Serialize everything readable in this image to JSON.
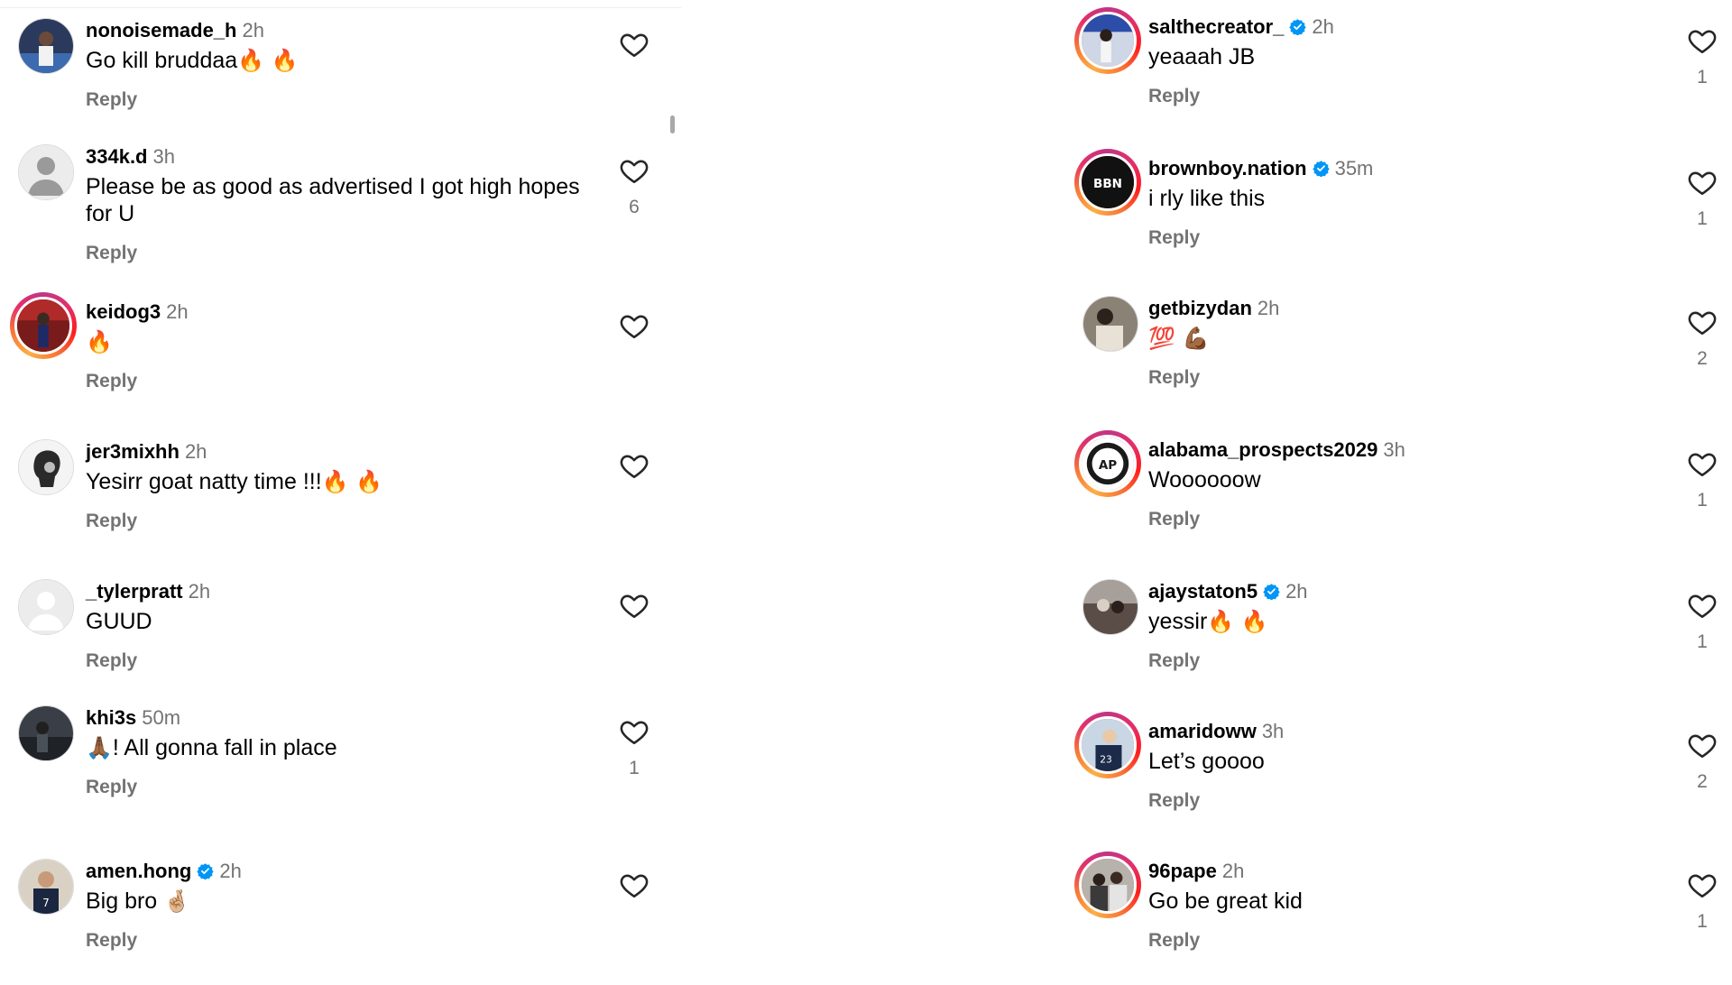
{
  "left_comments": [
    {
      "username": "nonoisemade_h",
      "verified": false,
      "time": "2h",
      "text": "Go kill bruddaa",
      "emoji": "🔥 🔥",
      "reply": "Reply",
      "likes": ""
    },
    {
      "username": "334k.d",
      "verified": false,
      "time": "3h",
      "text": "Please be as good as advertised I got high hopes for U",
      "emoji": "",
      "reply": "Reply",
      "likes": "6"
    },
    {
      "username": "keidog3",
      "verified": false,
      "time": "2h",
      "text": "",
      "emoji": "🔥",
      "reply": "Reply",
      "likes": ""
    },
    {
      "username": "jer3mixhh",
      "verified": false,
      "time": "2h",
      "text": "Yesirr goat natty time !!!",
      "emoji": "🔥 🔥",
      "reply": "Reply",
      "likes": ""
    },
    {
      "username": "_tylerpratt",
      "verified": false,
      "time": "2h",
      "text": "GUUD",
      "emoji": "",
      "reply": "Reply",
      "likes": ""
    },
    {
      "username": "khi3s",
      "verified": false,
      "time": "50m",
      "text": "! All gonna fall in place",
      "emoji": "🙏🏾",
      "reply": "Reply",
      "likes": "1"
    },
    {
      "username": "amen.hong",
      "verified": true,
      "time": "2h",
      "text": "Big bro",
      "emoji": "🤞🏼",
      "reply": "Reply",
      "likes": ""
    }
  ],
  "right_comments": [
    {
      "username": "salthecreator_",
      "verified": true,
      "time": "2h",
      "text": "yeaaah JB",
      "emoji": "",
      "reply": "Reply",
      "likes": "1"
    },
    {
      "username": "brownboy.nation",
      "verified": true,
      "time": "35m",
      "text": "i rly like this",
      "emoji": "",
      "reply": "Reply",
      "likes": "1"
    },
    {
      "username": "getbizydan",
      "verified": false,
      "time": "2h",
      "text": "",
      "emoji": "💯 💪🏾",
      "reply": "Reply",
      "likes": "2"
    },
    {
      "username": "alabama_prospects2029",
      "verified": false,
      "time": "3h",
      "text": "Woooooow",
      "emoji": "",
      "reply": "Reply",
      "likes": "1"
    },
    {
      "username": "ajaystaton5",
      "verified": true,
      "time": "2h",
      "text": "yessir",
      "emoji": "🔥 🔥",
      "reply": "Reply",
      "likes": "1"
    },
    {
      "username": "amaridoww",
      "verified": false,
      "time": "3h",
      "text": "Let’s goooo",
      "emoji": "",
      "reply": "Reply",
      "likes": "2"
    },
    {
      "username": "96pape",
      "verified": false,
      "time": "2h",
      "text": "Go be great kid",
      "emoji": "",
      "reply": "Reply",
      "likes": "1"
    }
  ],
  "colors": {
    "verified_blue": "#0095f6",
    "muted_text": "#737373",
    "story_ring": "#e1306c"
  },
  "icons": {
    "like": "heart-outline-icon",
    "verified": "verified-badge-icon",
    "default_avatar": "person-silhouette-icon"
  }
}
